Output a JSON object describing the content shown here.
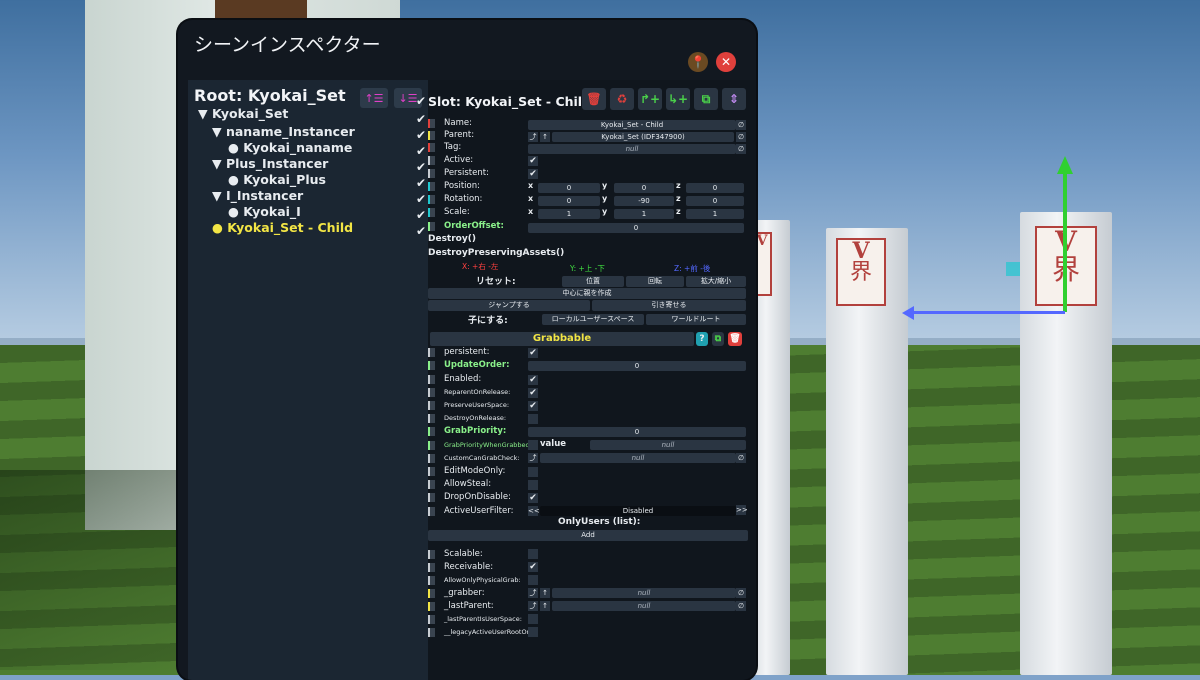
{
  "panel": {
    "title": "シーンインスペクター",
    "pin_icon": "pin-icon",
    "close_icon": "close-icon",
    "close_glyph": "✕",
    "pin_glyph": "📍"
  },
  "tree": {
    "root_label": "Root: Kyokai_Set",
    "btn_up": "↑☰",
    "btn_down": "↓☰",
    "items": [
      {
        "label": "▼ Kyokai_Set"
      },
      {
        "label": "▼ naname_Instancer"
      },
      {
        "label": "● Kyokai_naname"
      },
      {
        "label": "▼ Plus_Instancer"
      },
      {
        "label": "● Kyokai_Plus"
      },
      {
        "label": "▼ I_Instancer"
      },
      {
        "label": "● Kyokai_I"
      },
      {
        "label": "● Kyokai_Set - Child"
      }
    ],
    "check": "✔"
  },
  "slot": {
    "label": "Slot: Kyokai_Set - Child",
    "actions": [
      "🗑",
      "♻",
      "↱+",
      "↳+",
      "⧉",
      "⇕"
    ]
  },
  "fields": {
    "name_label": "Name:",
    "name_value": "Kyokai_Set - Child",
    "parent_label": "Parent:",
    "parent_value": "Kyokai_Set (IDF347900)",
    "tag_label": "Tag:",
    "tag_value": "null",
    "active_label": "Active:",
    "persistent_label": "Persistent:",
    "position_label": "Position:",
    "rotation_label": "Rotation:",
    "scale_label": "Scale:",
    "order_label": "OrderOffset:",
    "order_value": "0",
    "position": [
      "0",
      "0",
      "0"
    ],
    "rotation": [
      "0",
      "-90",
      "0"
    ],
    "scale": [
      "1",
      "1",
      "1"
    ],
    "x": "x",
    "y": "y",
    "z": "z",
    "clear": "∅",
    "arrow_up": "⤴",
    "arrow_up2": "↑",
    "check": "✔"
  },
  "actions": {
    "destroy": "Destroy()",
    "destroy_preserving": "DestroyPreservingAssets()",
    "axis_x": "X: +右 -左",
    "axis_y": "Y: +上 -下",
    "axis_z": "Z: +前 -後",
    "reset": "リセット:",
    "reset_position": "位置",
    "reset_rotation": "回転",
    "reset_scale": "拡大/縮小",
    "create_parent": "中心に親を作成",
    "jump": "ジャンプする",
    "pull": "引き寄せる",
    "make_child": "子にする:",
    "local_user_space": "ローカルユーザースペース",
    "world_root": "ワールドルート"
  },
  "grabbable": {
    "header": "Grabbable",
    "help": "?",
    "dup": "⧉",
    "del": "🗑",
    "persistent": "persistent:",
    "update_order": "UpdateOrder:",
    "update_order_value": "0",
    "enabled": "Enabled:",
    "reparent": "ReparentOnRelease:",
    "preserve": "PreserveUserSpace:",
    "destroy_on_release": "DestroyOnRelease:",
    "grab_priority": "GrabPriority:",
    "grab_priority_value": "0",
    "grab_priority_when": "GrabPriorityWhenGrabbed:",
    "value_label": "value",
    "value_value": "null",
    "custom_can_grab": "CustomCanGrabCheck:",
    "custom_value": "null",
    "edit_mode_only": "EditModeOnly:",
    "allow_steal": "AllowSteal:",
    "drop_on_disable": "DropOnDisable:",
    "active_user_filter": "ActiveUserFilter:",
    "filter_value": "Disabled",
    "filter_prev": "<<",
    "filter_next": ">>",
    "only_users": "OnlyUsers (list):",
    "add": "Add",
    "scalable": "Scalable:",
    "receivable": "Receivable:",
    "allow_only_physical": "AllowOnlyPhysicalGrab:",
    "grabber": "_grabber:",
    "grabber_value": "null",
    "last_parent": "_lastParent:",
    "last_parent_value": "null",
    "last_parent_user_space": "_lastParentIsUserSpace:",
    "legacy_active_user_root": "__legacyActiveUserRootOnly:"
  },
  "scene": {
    "sign_v": "V",
    "sign_kanji": "界"
  },
  "colors": {
    "panel_bg": "#121820",
    "tree_bg": "#1b2632",
    "selected": "#f2e545",
    "accent_red": "#e0403c",
    "green_label": "#8af08a"
  }
}
